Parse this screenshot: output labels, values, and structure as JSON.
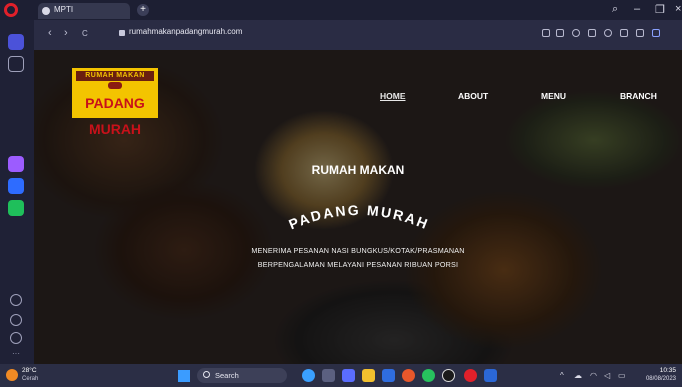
{
  "browser": {
    "tab_title": "MPTI",
    "url": "rumahmakanpadangmurah.com",
    "new_tab_label": "+",
    "back": "‹",
    "forward": "›",
    "reload": "C"
  },
  "site": {
    "logo_top": "RUMAH MAKAN",
    "logo_bottom": "PADANG MURAH",
    "nav": [
      {
        "label": "HOME"
      },
      {
        "label": "ABOUT"
      },
      {
        "label": "MENU"
      },
      {
        "label": "BRANCH"
      }
    ],
    "hero_title": "RUMAH MAKAN",
    "hero_arc": "PADANG MURAH",
    "hero_line1": "MENERIMA PESANAN NASI BUNGKUS/KOTAK/PRASMANAN",
    "hero_line2": "BERPENGALAMAN MELAYANI PESANAN RIBUAN PORSI"
  },
  "taskbar": {
    "temperature": "28°C",
    "weather": "Cerah",
    "search": "Search",
    "time": "10:35",
    "date": "08/08/2023"
  },
  "colors": {
    "accent_logo": "#f3c400",
    "logo_red": "#c8111a",
    "chrome_dark": "#1d1f33"
  }
}
